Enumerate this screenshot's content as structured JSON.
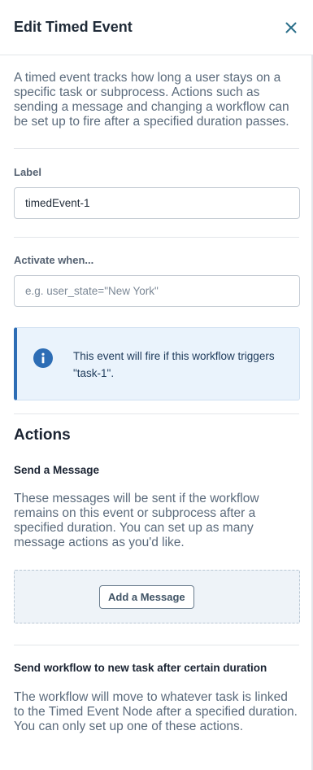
{
  "header": {
    "title": "Edit Timed Event",
    "close_icon": "close-icon"
  },
  "intro": "A timed event tracks how long a user stays on a specific task or subprocess. Actions such as sending a message and changing a workflow can be set up to fire after a specified duration passes.",
  "label_field": {
    "label": "Label",
    "value": "timedEvent-1"
  },
  "activate_field": {
    "label": "Activate when...",
    "value": "",
    "placeholder": "e.g. user_state=\"New York\""
  },
  "info": {
    "icon": "info-icon",
    "text": "This event will fire if this workflow triggers \"task-1\"."
  },
  "actions": {
    "heading": "Actions",
    "send_message": {
      "title": "Send a Message",
      "description": "These messages will be sent if the workflow remains on this event or subprocess after a specified duration. You can set up as many message actions as you'd like.",
      "button_label": "Add a Message"
    },
    "send_workflow": {
      "title": "Send workflow to new task after certain duration",
      "description": "The workflow will move to whatever task is linked to the Timed Event Node after a specified duration. You can only set up one of these actions."
    }
  },
  "colors": {
    "accent": "#2d6db5",
    "info_bg": "#eaf3fc",
    "muted_text": "#5b6b7c"
  }
}
